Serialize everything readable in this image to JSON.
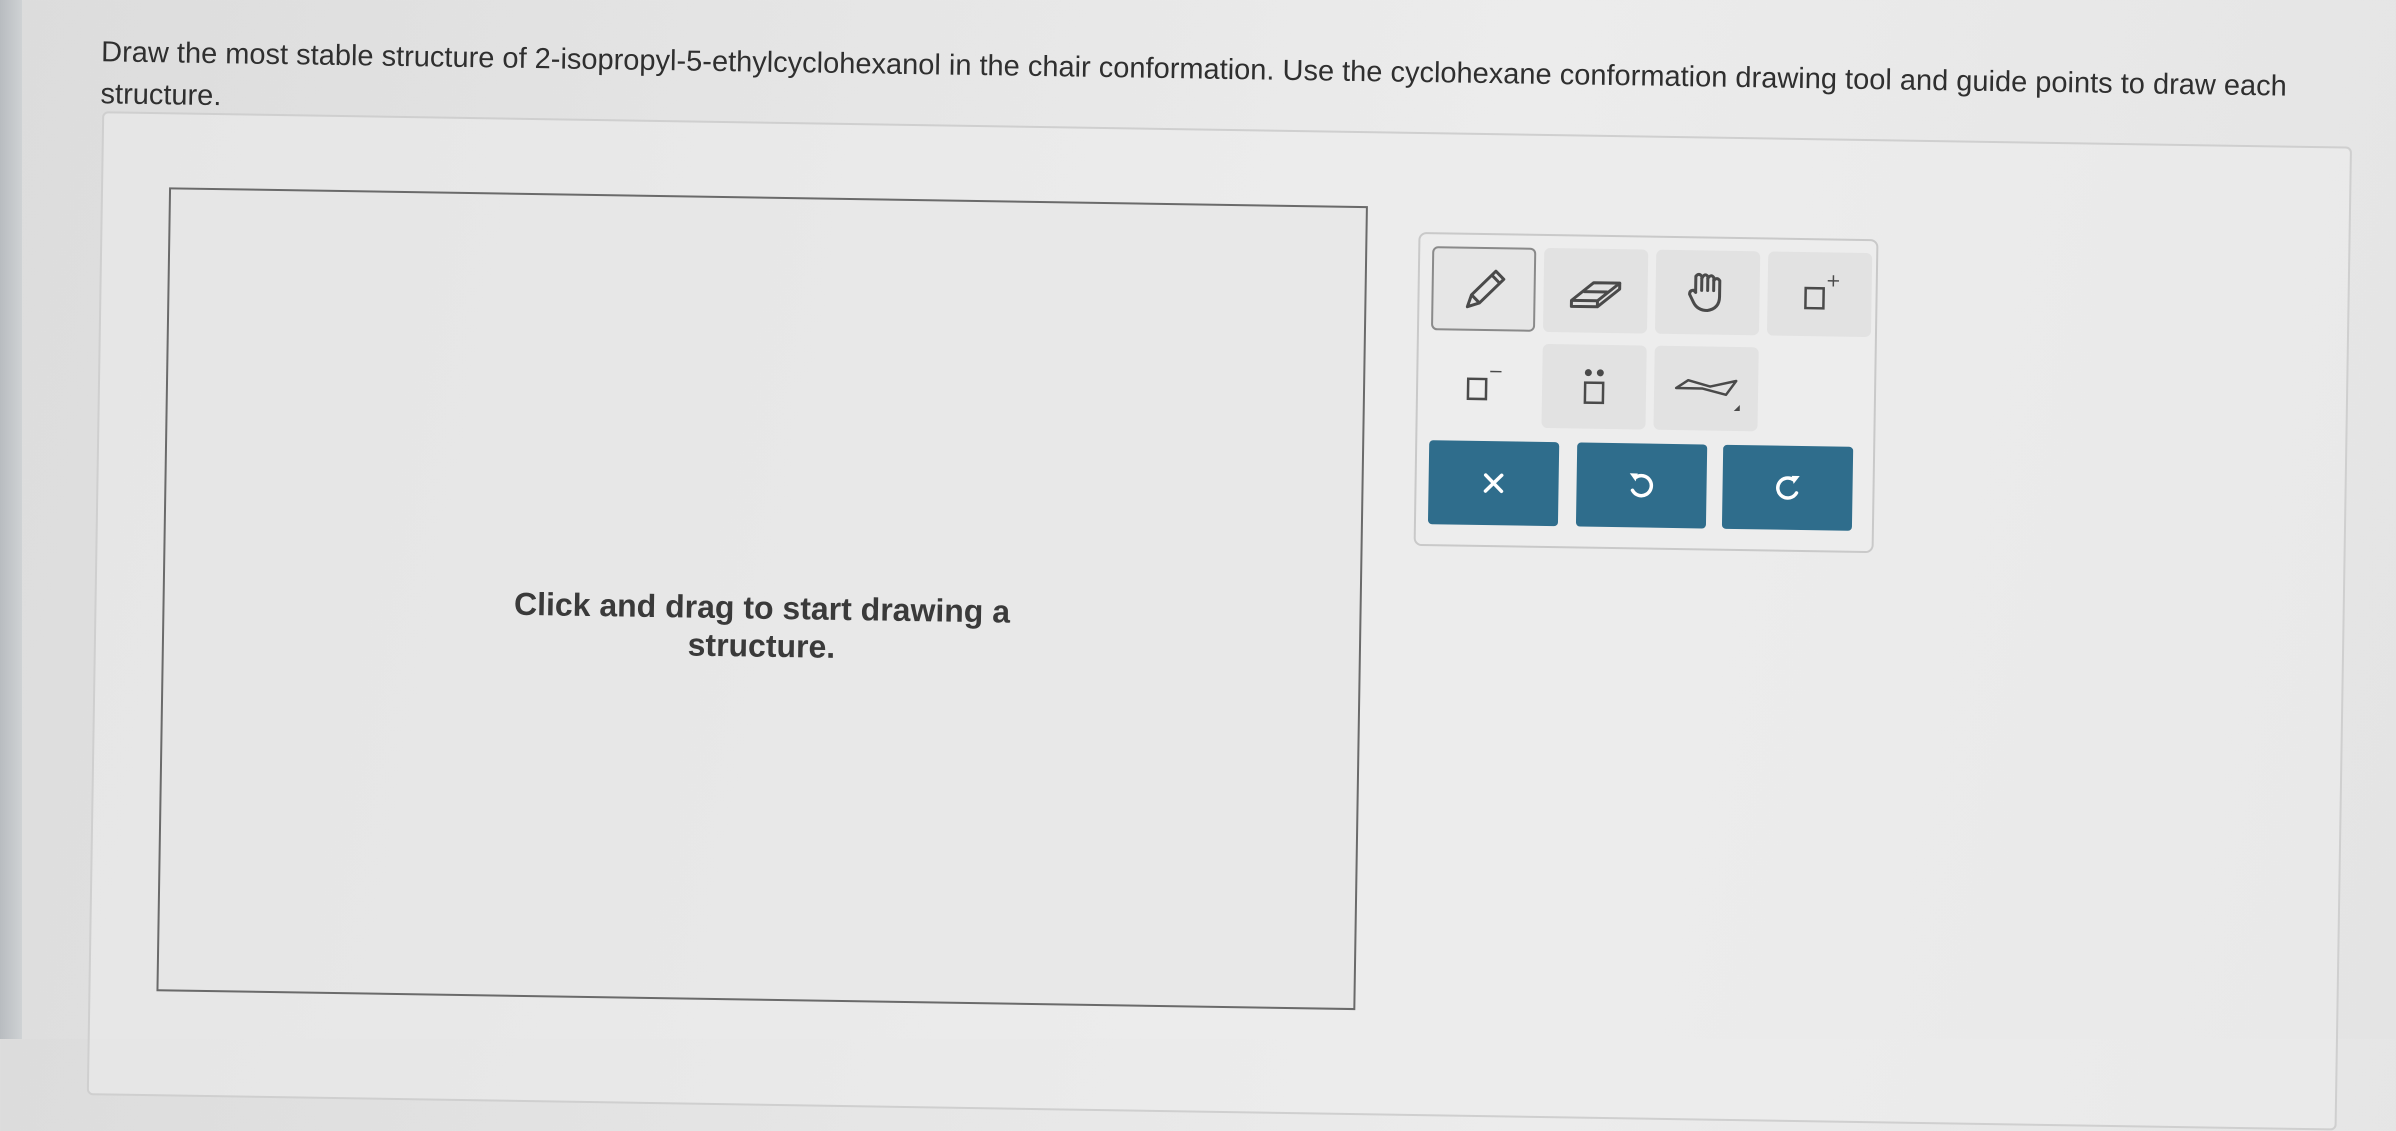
{
  "question": {
    "text": "Draw the most stable structure of 2-isopropyl-5-ethylcyclohexanol in the chair conformation. Use the cyclohexane conformation drawing tool and guide points to draw each structure."
  },
  "canvas": {
    "hint": "Click and drag to start drawing a structure."
  },
  "toolbar": {
    "tools": [
      {
        "name": "pencil-tool",
        "icon": "pencil-icon",
        "selected": true
      },
      {
        "name": "eraser-tool",
        "icon": "eraser-icon",
        "selected": false
      },
      {
        "name": "hand-tool",
        "icon": "hand-icon",
        "selected": false
      },
      {
        "name": "positive-charge-tool",
        "icon": "positive-charge-icon",
        "selected": false
      },
      {
        "name": "negative-charge-tool",
        "icon": "negative-charge-icon",
        "selected": false
      },
      {
        "name": "lone-pair-tool",
        "icon": "lone-pair-icon",
        "selected": false
      },
      {
        "name": "chair-template-tool",
        "icon": "chair-cyclohexane-icon",
        "selected": false
      }
    ],
    "actions": [
      {
        "name": "clear-button",
        "icon": "x-icon"
      },
      {
        "name": "undo-button",
        "icon": "undo-icon"
      },
      {
        "name": "redo-button",
        "icon": "redo-icon"
      }
    ],
    "charge_plus": "+",
    "charge_minus": "−"
  },
  "colors": {
    "action_button": "#2f6d8c",
    "tool_background": "#e2e2e2",
    "icon_stroke": "#4a4a4a"
  }
}
